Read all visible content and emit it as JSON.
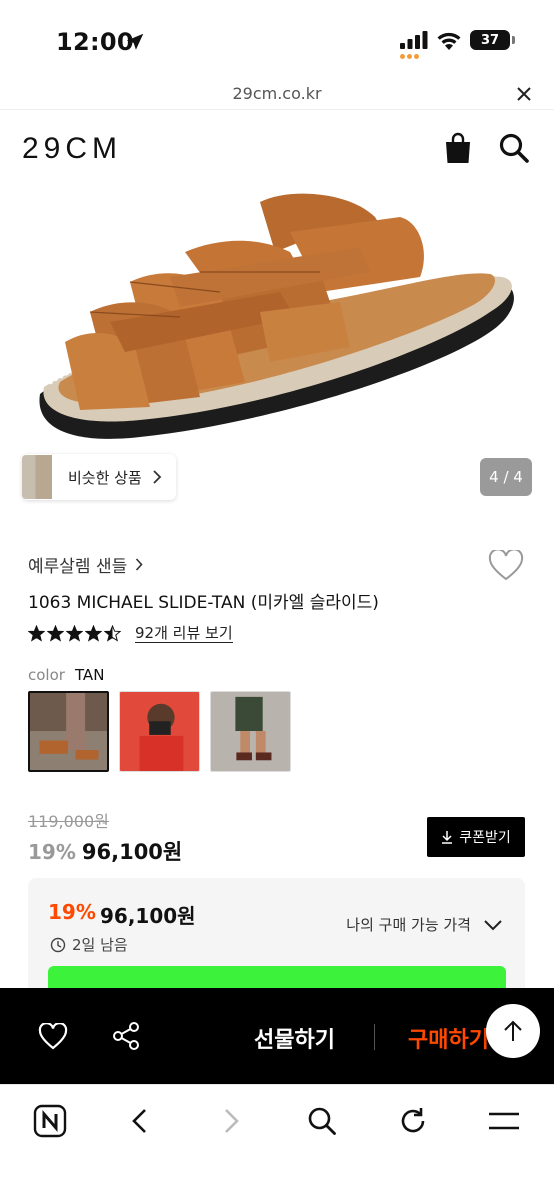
{
  "status_bar": {
    "time": "12:00",
    "battery": "37"
  },
  "browser": {
    "url": "29cm.co.kr"
  },
  "header": {
    "logo": "29CM"
  },
  "hero": {
    "similar_label": "비슷한 상품",
    "image_counter": "4 / 4"
  },
  "product": {
    "brand": "예루살렘 샌들",
    "title": "1063 MICHAEL SLIDE-TAN (미카엘 슬라이드)",
    "rating": 4.5,
    "review_link": "92개 리뷰 보기",
    "color_label": "color",
    "color_value": "TAN"
  },
  "price": {
    "original": "119,000원",
    "discount": "19%",
    "current": "96,100원",
    "coupon_button": "쿠폰받기"
  },
  "price_card": {
    "discount": "19%",
    "price": "96,100원",
    "days_left": "2일 남음",
    "my_price_label": "나의 구매 가능 가격"
  },
  "buy_bar": {
    "gift_label": "선물하기",
    "buy_label": "구매하기"
  },
  "colors": {
    "accent": "#ff4800",
    "banner": "#3df23a"
  }
}
